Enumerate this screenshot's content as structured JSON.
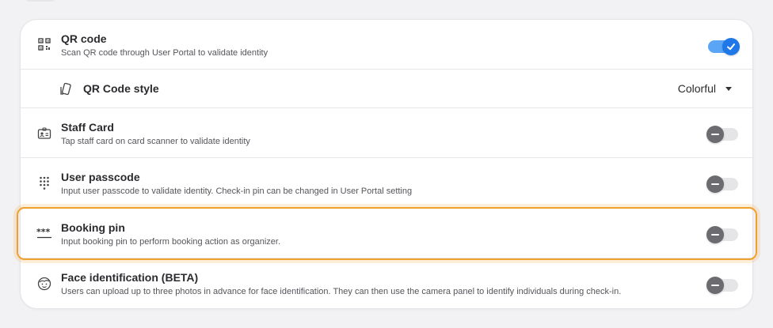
{
  "header": {
    "partial_text": ""
  },
  "options": [
    {
      "title": "QR code",
      "description": "Scan QR code through User Portal to validate identity",
      "icon": "qr-code-icon",
      "enabled": true
    },
    {
      "title": "Staff Card",
      "description": "Tap staff card on card scanner to validate identity",
      "icon": "id-card-icon",
      "enabled": false
    },
    {
      "title": "User passcode",
      "description": "Input user passcode to validate identity. Check-in pin can be changed in User Portal setting",
      "icon": "keypad-icon",
      "enabled": false
    },
    {
      "title": "Booking pin",
      "description": "Input booking pin to perform booking action as organizer.",
      "icon": "password-dots-icon",
      "enabled": false,
      "highlighted": true
    },
    {
      "title": "Face identification (BETA)",
      "description": "Users can upload up to three photos in advance for face identification. They can then use the camera panel to identify individuals during check-in.",
      "icon": "face-icon",
      "enabled": false
    }
  ],
  "qr_code_style": {
    "label": "QR Code style",
    "value": "Colorful",
    "icon": "qr-style-icon"
  },
  "colors": {
    "toggle_on": "#1f78e8",
    "toggle_off_knob": "#6b6b70",
    "highlight": "#f2a02c"
  }
}
